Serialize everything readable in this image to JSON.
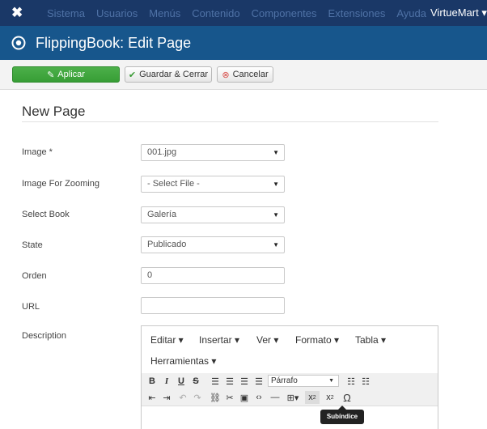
{
  "topnav": {
    "items": [
      "Sistema",
      "Usuarios",
      "Menús",
      "Contenido",
      "Componentes",
      "Extensiones",
      "Ayuda"
    ],
    "virtuemart": "VirtueMart ▾",
    "bg_color": "#1a3867"
  },
  "title": {
    "text": "FlippingBook: Edit Page",
    "bg_color": "#17568c"
  },
  "toolbar": {
    "apply": "Aplicar",
    "save_close": "Guardar & Cerrar",
    "cancel": "Cancelar"
  },
  "form": {
    "heading": "New Page",
    "fields": {
      "image": {
        "label": "Image *",
        "value": "001.jpg"
      },
      "zoom": {
        "label": "Image For Zooming",
        "value": "- Select File -"
      },
      "book": {
        "label": "Select Book",
        "value": "Galería"
      },
      "state": {
        "label": "State",
        "value": "Publicado"
      },
      "orden": {
        "label": "Orden",
        "value": "0"
      },
      "url": {
        "label": "URL",
        "value": ""
      },
      "description": {
        "label": "Description"
      }
    }
  },
  "editor": {
    "menus": [
      "Editar ▾",
      "Insertar ▾",
      "Ver ▾",
      "Formato ▾",
      "Tabla ▾",
      "Herramientas ▾"
    ],
    "format_select": "Párrafo",
    "tooltip": "Subíndice"
  }
}
